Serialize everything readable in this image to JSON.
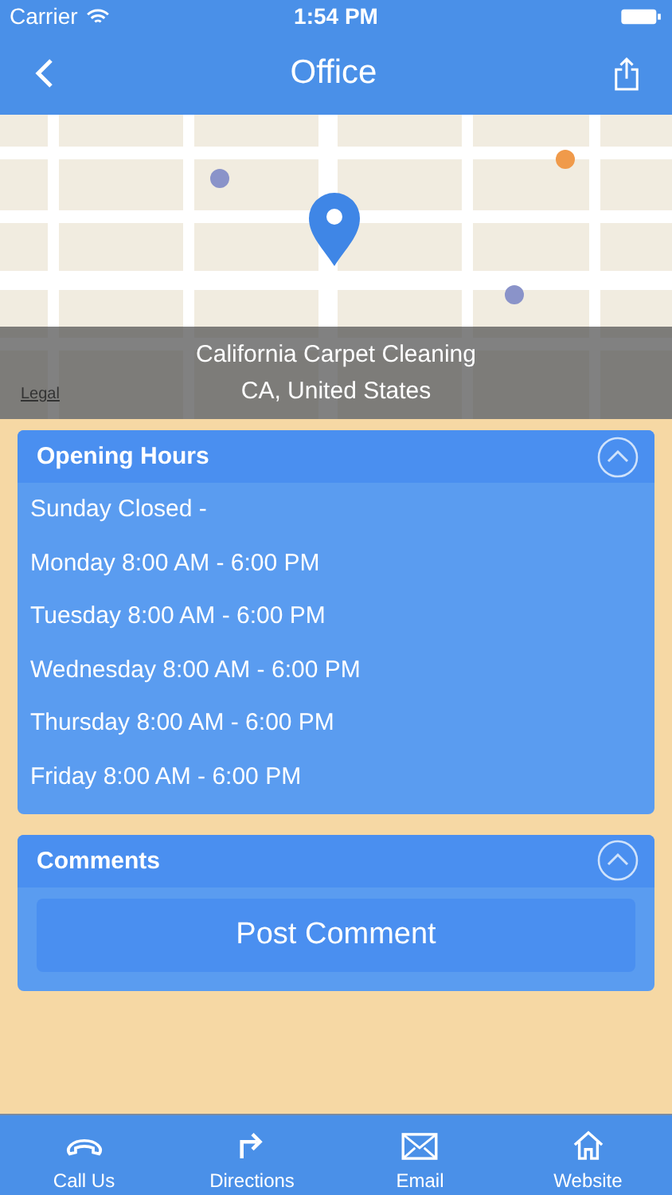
{
  "status_bar": {
    "carrier": "Carrier",
    "time": "1:54 PM"
  },
  "nav": {
    "title": "Office"
  },
  "map": {
    "kind": "picture",
    "place_name": "California Carpet Cleaning",
    "place_region": "CA, United States",
    "legal": "Legal"
  },
  "sections": [
    {
      "kind": "hours",
      "title": "Opening Hours",
      "expanded": true,
      "rows": [
        "Sunday Closed -",
        "Monday 8:00 AM - 6:00 PM",
        "Tuesday 8:00 AM - 6:00 PM",
        "Wednesday 8:00 AM - 6:00 PM",
        "Thursday 8:00 AM - 6:00 PM",
        "Friday 8:00 AM - 6:00 PM"
      ]
    },
    {
      "kind": "comments",
      "title": "Comments",
      "expanded": true,
      "button": "Post Comment"
    }
  ],
  "tab_bar": [
    {
      "kind": "phone",
      "label": "Call Us"
    },
    {
      "kind": "directions",
      "label": "Directions"
    },
    {
      "kind": "email",
      "label": "Email"
    },
    {
      "kind": "website",
      "label": "Website"
    }
  ]
}
